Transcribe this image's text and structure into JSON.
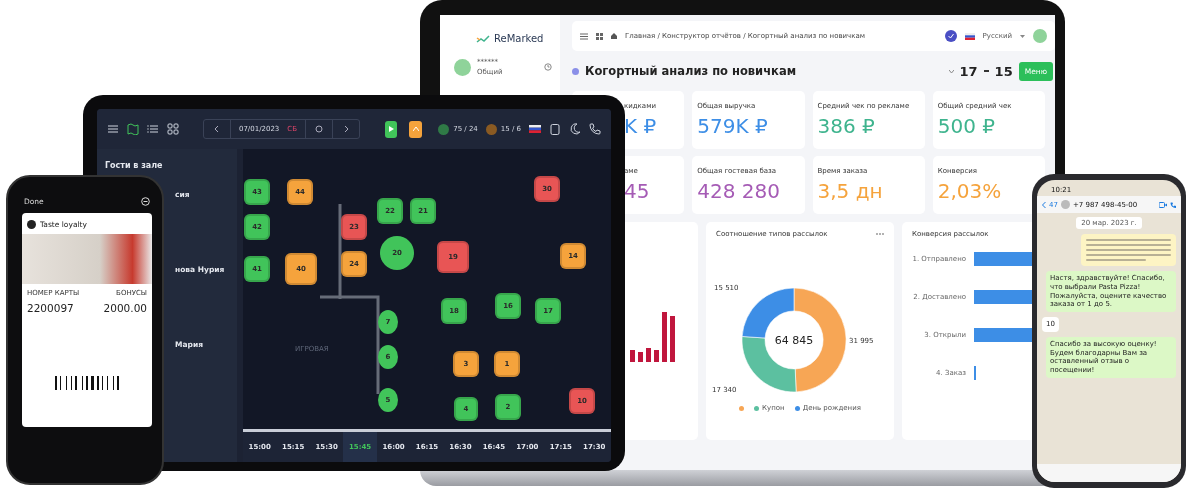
{
  "laptop": {
    "logo": "ReMarked",
    "user": {
      "name": "******",
      "role": "Общий"
    },
    "breadcrumb": "Главная / Конструктор отчётов / Когортный анализ по новичкам",
    "language": "Русский",
    "page_title": "Когортный анализ по новичкам",
    "date_range": [
      "17",
      "15"
    ],
    "menu_button": "Меню",
    "kpis": [
      {
        "label": "кидками",
        "value": "K ₽",
        "color": "#3d8ee6"
      },
      {
        "label": "Общая выручка",
        "value": "579K ₽",
        "color": "#3d8ee6"
      },
      {
        "label": "Средний чек по рекламе",
        "value": "386 ₽",
        "color": "#3fb48e"
      },
      {
        "label": "Общий средний чек",
        "value": "500 ₽",
        "color": "#3fb48e"
      },
      {
        "label": "аме",
        "value": "45",
        "color": "#a55bb5"
      },
      {
        "label": "Общая гостевая база",
        "value": "428 280",
        "color": "#a55bb5"
      },
      {
        "label": "Время заказа",
        "value": "3,5 дн",
        "color": "#f5a33c"
      },
      {
        "label": "Конверсия",
        "value": "2,03%",
        "color": "#f5a33c"
      }
    ],
    "mailing_types": {
      "center_label": "64 845",
      "legend": [
        {
          "color": "#f7a655"
        },
        {
          "label": "Купон",
          "color": "#5cc0a0"
        },
        {
          "label": "День рождения",
          "color": "#3d8ee6"
        }
      ],
      "chart_data": {
        "type": "donut",
        "title": "Соотношение типов рассылок",
        "values": [
          31995,
          17340,
          15510
        ],
        "value_labels": [
          "31 995",
          "17 340",
          "15 510"
        ]
      }
    },
    "conversion": {
      "title": "Конверсия рассылок",
      "stages": [
        "1. Отправлено",
        "2. Доставлено",
        "3. Открыли",
        "4. Заказ"
      ]
    }
  },
  "tablet": {
    "date": "07/01/2023",
    "weekday": "СБ",
    "counters": [
      "75 / 24",
      "15 / 6"
    ],
    "sidebar": {
      "title": "Гости в зале",
      "guests": [
        "сия",
        "нова Нурия",
        "Мария"
      ]
    },
    "floor": {
      "room_label": "ИГРОВАЯ",
      "tables": [
        {
          "number": "43",
          "kind": "square",
          "color": "#41c45a"
        },
        {
          "number": "44",
          "kind": "square",
          "color": "#f5a33c"
        },
        {
          "number": "42",
          "kind": "square",
          "color": "#41c45a"
        },
        {
          "number": "41",
          "kind": "square",
          "color": "#41c45a"
        },
        {
          "number": "40",
          "kind": "square",
          "color": "#f5a33c"
        },
        {
          "number": "23",
          "kind": "square",
          "color": "#e85555"
        },
        {
          "number": "22",
          "kind": "square",
          "color": "#41c45a"
        },
        {
          "number": "21",
          "kind": "square",
          "color": "#41c45a"
        },
        {
          "number": "20",
          "kind": "round",
          "color": "#41c45a"
        },
        {
          "number": "19",
          "kind": "square",
          "color": "#e85555"
        },
        {
          "number": "24",
          "kind": "square",
          "color": "#f5a33c"
        },
        {
          "number": "30",
          "kind": "square",
          "color": "#e85555"
        },
        {
          "number": "14",
          "kind": "square",
          "color": "#f5a33c"
        },
        {
          "number": "18",
          "kind": "square",
          "color": "#41c45a"
        },
        {
          "number": "16",
          "kind": "square",
          "color": "#41c45a"
        },
        {
          "number": "17",
          "kind": "square",
          "color": "#41c45a"
        },
        {
          "number": "7",
          "kind": "round",
          "color": "#41c45a"
        },
        {
          "number": "6",
          "kind": "round",
          "color": "#41c45a"
        },
        {
          "number": "5",
          "kind": "round",
          "color": "#41c45a"
        },
        {
          "number": "3",
          "kind": "square",
          "color": "#f5a33c"
        },
        {
          "number": "1",
          "kind": "square",
          "color": "#f5a33c"
        },
        {
          "number": "4",
          "kind": "square",
          "color": "#41c45a"
        },
        {
          "number": "2",
          "kind": "square",
          "color": "#41c45a"
        },
        {
          "number": "10",
          "kind": "square",
          "color": "#e85555"
        }
      ]
    },
    "timeline": [
      {
        "time": "15:00",
        "selected": false
      },
      {
        "time": "15:15",
        "selected": false
      },
      {
        "time": "15:30",
        "selected": false
      },
      {
        "time": "15:45",
        "selected": true
      },
      {
        "time": "16:00",
        "selected": false
      },
      {
        "time": "16:15",
        "selected": false
      },
      {
        "time": "16:30",
        "selected": false
      },
      {
        "time": "16:45",
        "selected": false
      },
      {
        "time": "17:00",
        "selected": false
      },
      {
        "time": "17:15",
        "selected": false
      },
      {
        "time": "17:30",
        "selected": false
      }
    ]
  },
  "wallet_phone": {
    "done": "Done",
    "card": {
      "title": "Taste loyalty",
      "number_label": "НОМЕР КАРТЫ",
      "bonus_label": "БОНУСЫ",
      "number": "2200097",
      "bonus": "2000.00"
    }
  },
  "chat_phone": {
    "time": "10:21",
    "back_count": "47",
    "contact": "+7 987 498-45-00",
    "date": "20 мар. 2023 г.",
    "messages": [
      {
        "kind": "notice"
      },
      {
        "kind": "outgoing",
        "text": "Настя, здравствуйте! Спасибо, что выбрали Pasta Pizza! Пожалуйста, оцените качество заказа от 1 до 5."
      },
      {
        "kind": "incoming",
        "text": "10"
      },
      {
        "kind": "outgoing",
        "text": "Спасибо за высокую оценку! Будем благодарны Вам за оставленный отзыв о посещении!"
      }
    ]
  }
}
